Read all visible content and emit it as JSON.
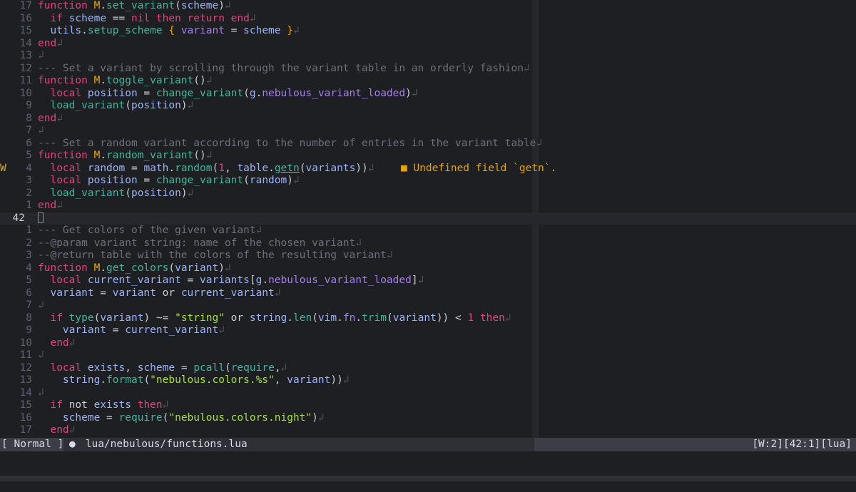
{
  "editor": {
    "newline_glyph": "↲",
    "lines": [
      {
        "num": "17",
        "sign": "",
        "tokens": [
          [
            "kw",
            "function "
          ],
          [
            "mod",
            "M"
          ],
          [
            "op",
            "."
          ],
          [
            "fn",
            "set_variant"
          ],
          [
            "op",
            "("
          ],
          [
            "id",
            "scheme"
          ],
          [
            "op",
            ")"
          ]
        ]
      },
      {
        "num": "16",
        "sign": "",
        "tokens": [
          [
            "op",
            "  "
          ],
          [
            "kw",
            "if "
          ],
          [
            "id",
            "scheme"
          ],
          [
            "op",
            " == "
          ],
          [
            "kw",
            "nil "
          ],
          [
            "kw",
            "then "
          ],
          [
            "kw",
            "return "
          ],
          [
            "kw",
            "end"
          ]
        ]
      },
      {
        "num": "15",
        "sign": "",
        "tokens": [
          [
            "op",
            "  "
          ],
          [
            "id",
            "utils"
          ],
          [
            "op",
            "."
          ],
          [
            "fn",
            "setup_scheme"
          ],
          [
            "op",
            " "
          ],
          [
            "mod",
            "{"
          ],
          [
            "op",
            " "
          ],
          [
            "fld",
            "variant"
          ],
          [
            "op",
            " = "
          ],
          [
            "id",
            "scheme"
          ],
          [
            "op",
            " "
          ],
          [
            "mod",
            "}"
          ]
        ]
      },
      {
        "num": "14",
        "sign": "",
        "tokens": [
          [
            "kw",
            "end"
          ]
        ]
      },
      {
        "num": "13",
        "sign": "",
        "tokens": []
      },
      {
        "num": "12",
        "sign": "",
        "tokens": [
          [
            "cm",
            "--- Set a variant by scrolling through the variant table in an orderly fashion"
          ]
        ]
      },
      {
        "num": "11",
        "sign": "",
        "tokens": [
          [
            "kw",
            "function "
          ],
          [
            "mod",
            "M"
          ],
          [
            "op",
            "."
          ],
          [
            "fn",
            "toggle_variant"
          ],
          [
            "op",
            "()"
          ]
        ]
      },
      {
        "num": "10",
        "sign": "",
        "tokens": [
          [
            "op",
            "  "
          ],
          [
            "kw",
            "local "
          ],
          [
            "id",
            "position"
          ],
          [
            "op",
            " = "
          ],
          [
            "fn",
            "change_variant"
          ],
          [
            "op",
            "("
          ],
          [
            "id",
            "g"
          ],
          [
            "op",
            "."
          ],
          [
            "fld",
            "nebulous_variant_loaded"
          ],
          [
            "op",
            ")"
          ]
        ]
      },
      {
        "num": "9",
        "sign": "",
        "tokens": [
          [
            "op",
            "  "
          ],
          [
            "fn",
            "load_variant"
          ],
          [
            "op",
            "("
          ],
          [
            "id",
            "position"
          ],
          [
            "op",
            ")"
          ]
        ]
      },
      {
        "num": "8",
        "sign": "",
        "tokens": [
          [
            "kw",
            "end"
          ]
        ]
      },
      {
        "num": "7",
        "sign": "",
        "tokens": []
      },
      {
        "num": "6",
        "sign": "",
        "tokens": [
          [
            "cm",
            "--- Set a random variant according to the number of entries in the variant table"
          ]
        ]
      },
      {
        "num": "5",
        "sign": "",
        "tokens": [
          [
            "kw",
            "function "
          ],
          [
            "mod",
            "M"
          ],
          [
            "op",
            "."
          ],
          [
            "fn",
            "random_variant"
          ],
          [
            "op",
            "()"
          ]
        ]
      },
      {
        "num": "4",
        "sign": "W",
        "tokens": [
          [
            "op",
            "  "
          ],
          [
            "kw",
            "local "
          ],
          [
            "id",
            "random"
          ],
          [
            "op",
            " = "
          ],
          [
            "id",
            "math"
          ],
          [
            "op",
            "."
          ],
          [
            "fn",
            "random"
          ],
          [
            "op",
            "("
          ],
          [
            "num",
            "1"
          ],
          [
            "op",
            ", "
          ],
          [
            "id",
            "table"
          ],
          [
            "op",
            "."
          ],
          [
            "fn ul",
            "getn"
          ],
          [
            "op",
            "("
          ],
          [
            "id",
            "variants"
          ],
          [
            "op",
            "))"
          ]
        ],
        "virtual_text": "■ Undefined field `getn`."
      },
      {
        "num": "3",
        "sign": "",
        "tokens": [
          [
            "op",
            "  "
          ],
          [
            "kw",
            "local "
          ],
          [
            "id",
            "position"
          ],
          [
            "op",
            " = "
          ],
          [
            "fn",
            "change_variant"
          ],
          [
            "op",
            "("
          ],
          [
            "id",
            "random"
          ],
          [
            "op",
            ")"
          ]
        ]
      },
      {
        "num": "2",
        "sign": "",
        "tokens": [
          [
            "op",
            "  "
          ],
          [
            "fn",
            "load_variant"
          ],
          [
            "op",
            "("
          ],
          [
            "id",
            "position"
          ],
          [
            "op",
            ")"
          ]
        ]
      },
      {
        "num": "1",
        "sign": "",
        "tokens": [
          [
            "kw",
            "end"
          ]
        ]
      },
      {
        "num": "42",
        "sign": "",
        "current": true,
        "tokens": []
      },
      {
        "num": "1",
        "sign": "",
        "tokens": [
          [
            "cm",
            "--- Get colors of the given variant"
          ]
        ]
      },
      {
        "num": "2",
        "sign": "",
        "tokens": [
          [
            "cm",
            "--@param variant string: name of the chosen variant"
          ]
        ]
      },
      {
        "num": "3",
        "sign": "",
        "tokens": [
          [
            "cm",
            "--@return table with the colors of the resulting variant"
          ]
        ]
      },
      {
        "num": "4",
        "sign": "",
        "tokens": [
          [
            "kw",
            "function "
          ],
          [
            "mod",
            "M"
          ],
          [
            "op",
            "."
          ],
          [
            "fn",
            "get_colors"
          ],
          [
            "op",
            "("
          ],
          [
            "id",
            "variant"
          ],
          [
            "op",
            ")"
          ]
        ]
      },
      {
        "num": "5",
        "sign": "",
        "tokens": [
          [
            "op",
            "  "
          ],
          [
            "kw",
            "local "
          ],
          [
            "id",
            "current_variant"
          ],
          [
            "op",
            " = "
          ],
          [
            "id",
            "variants"
          ],
          [
            "op",
            "["
          ],
          [
            "id",
            "g"
          ],
          [
            "op",
            "."
          ],
          [
            "fld",
            "nebulous_variant_loaded"
          ],
          [
            "op",
            "]"
          ]
        ]
      },
      {
        "num": "6",
        "sign": "",
        "tokens": [
          [
            "op",
            "  "
          ],
          [
            "id",
            "variant"
          ],
          [
            "op",
            " = "
          ],
          [
            "id",
            "variant"
          ],
          [
            "op",
            " or "
          ],
          [
            "id",
            "current_variant"
          ]
        ]
      },
      {
        "num": "7",
        "sign": "",
        "tokens": []
      },
      {
        "num": "8",
        "sign": "",
        "tokens": [
          [
            "op",
            "  "
          ],
          [
            "kw",
            "if "
          ],
          [
            "fn",
            "type"
          ],
          [
            "op",
            "("
          ],
          [
            "id",
            "variant"
          ],
          [
            "op",
            ") ~= "
          ],
          [
            "str",
            "\"string\""
          ],
          [
            "op",
            " or "
          ],
          [
            "id",
            "string"
          ],
          [
            "op",
            "."
          ],
          [
            "fn",
            "len"
          ],
          [
            "op",
            "("
          ],
          [
            "id",
            "vim"
          ],
          [
            "op",
            "."
          ],
          [
            "fld",
            "fn"
          ],
          [
            "op",
            "."
          ],
          [
            "fn",
            "trim"
          ],
          [
            "op",
            "("
          ],
          [
            "id",
            "variant"
          ],
          [
            "op",
            ")) < "
          ],
          [
            "num",
            "1"
          ],
          [
            "op",
            " "
          ],
          [
            "kw",
            "then"
          ]
        ]
      },
      {
        "num": "9",
        "sign": "",
        "tokens": [
          [
            "op",
            "    "
          ],
          [
            "id",
            "variant"
          ],
          [
            "op",
            " = "
          ],
          [
            "id",
            "current_variant"
          ]
        ]
      },
      {
        "num": "10",
        "sign": "",
        "tokens": [
          [
            "op",
            "  "
          ],
          [
            "kw",
            "end"
          ]
        ]
      },
      {
        "num": "11",
        "sign": "",
        "tokens": []
      },
      {
        "num": "12",
        "sign": "",
        "tokens": [
          [
            "op",
            "  "
          ],
          [
            "kw",
            "local "
          ],
          [
            "id",
            "exists"
          ],
          [
            "op",
            ", "
          ],
          [
            "id",
            "scheme"
          ],
          [
            "op",
            " = "
          ],
          [
            "fn",
            "pcall"
          ],
          [
            "op",
            "("
          ],
          [
            "fn",
            "require"
          ],
          [
            "op",
            ","
          ]
        ]
      },
      {
        "num": "13",
        "sign": "",
        "tokens": [
          [
            "op",
            "    "
          ],
          [
            "id",
            "string"
          ],
          [
            "op",
            "."
          ],
          [
            "fn",
            "format"
          ],
          [
            "op",
            "("
          ],
          [
            "str",
            "\"nebulous.colors.%s\""
          ],
          [
            "op",
            ", "
          ],
          [
            "id",
            "variant"
          ],
          [
            "op",
            "))"
          ]
        ]
      },
      {
        "num": "14",
        "sign": "",
        "tokens": []
      },
      {
        "num": "15",
        "sign": "",
        "tokens": [
          [
            "op",
            "  "
          ],
          [
            "kw",
            "if "
          ],
          [
            "op",
            "not "
          ],
          [
            "id",
            "exists"
          ],
          [
            "op",
            " "
          ],
          [
            "kw",
            "then"
          ]
        ]
      },
      {
        "num": "16",
        "sign": "",
        "tokens": [
          [
            "op",
            "    "
          ],
          [
            "id",
            "scheme"
          ],
          [
            "op",
            " = "
          ],
          [
            "fn",
            "require"
          ],
          [
            "op",
            "("
          ],
          [
            "str",
            "\"nebulous.colors.night\""
          ],
          [
            "op",
            ")"
          ]
        ]
      },
      {
        "num": "17",
        "sign": "",
        "tokens": [
          [
            "op",
            "  "
          ],
          [
            "kw",
            "end"
          ]
        ]
      }
    ]
  },
  "statusline": {
    "mode": "[ Normal ]",
    "file_icon": "lua-icon",
    "file_path": "lua/nebulous/functions.lua",
    "right": "[W:2][42:1][lua]"
  }
}
